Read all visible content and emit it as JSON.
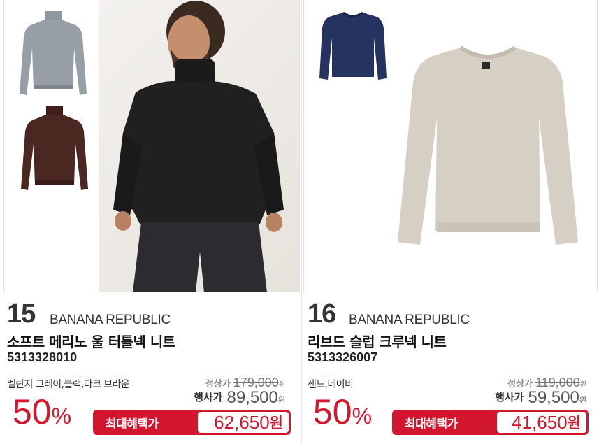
{
  "products": [
    {
      "rank": "15",
      "brand": "BANANA REPUBLIC",
      "name": "소프트 메리노 울 터틀넥 니트",
      "code": "5313328010",
      "colors": "멜란지 그레이,블랙,다크 브라운",
      "regular_label": "정상가",
      "regular_price": "179,000",
      "event_label": "행사가",
      "event_price": "89,500",
      "currency_small": "원",
      "discount_value": "50",
      "discount_unit": "%",
      "max_benefit_label": "최대혜택가",
      "max_benefit_price": "62,650",
      "currency": "원",
      "swatch_colors": [
        "#8f969e",
        "#4a2721",
        "#1c1c1c"
      ]
    },
    {
      "rank": "16",
      "brand": "BANANA REPUBLIC",
      "name": "리브드 슬럽 크루넥 니트",
      "code": "5313326007",
      "colors": "샌드,네이비",
      "regular_label": "정상가",
      "regular_price": "119,000",
      "event_label": "행사가",
      "event_price": "59,500",
      "currency_small": "원",
      "discount_value": "50",
      "discount_unit": "%",
      "max_benefit_label": "최대혜택가",
      "max_benefit_price": "41,650",
      "currency": "원",
      "swatch_colors": [
        "#24335f",
        "#d6cfc4"
      ]
    }
  ],
  "accent_color": "#d2162d"
}
